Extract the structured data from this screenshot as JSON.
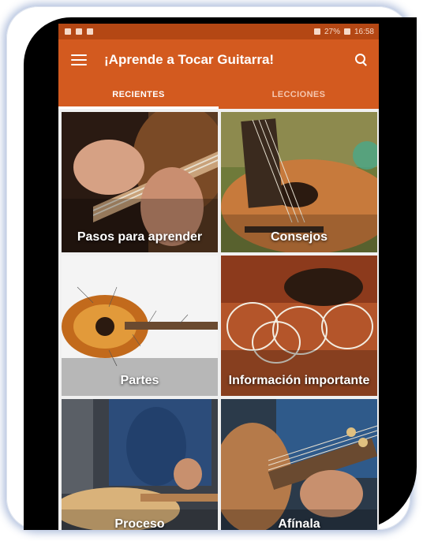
{
  "status_bar": {
    "battery": "27%",
    "time": "16:58"
  },
  "app_bar": {
    "title": "¡Aprende a Tocar Guitarra!"
  },
  "tabs": [
    {
      "label": "RECIENTES",
      "active": true
    },
    {
      "label": "LECCIONES",
      "active": false
    }
  ],
  "tiles": [
    {
      "label": "Pasos para aprender",
      "icon": "guitar-hand-photo"
    },
    {
      "label": "Consejos",
      "icon": "guitar-grass-photo"
    },
    {
      "label": "Partes",
      "icon": "guitar-diagram-photo"
    },
    {
      "label": "Información importante",
      "icon": "guitar-strings-photo"
    },
    {
      "label": "Proceso",
      "icon": "guitar-workshop-photo"
    },
    {
      "label": "Afínala",
      "icon": "guitar-tuning-photo"
    }
  ],
  "colors": {
    "app_bar": "#d35a1f",
    "status_bar": "#b44714",
    "tab_active": "#ffffff",
    "tab_inactive": "#f5c7b0"
  }
}
